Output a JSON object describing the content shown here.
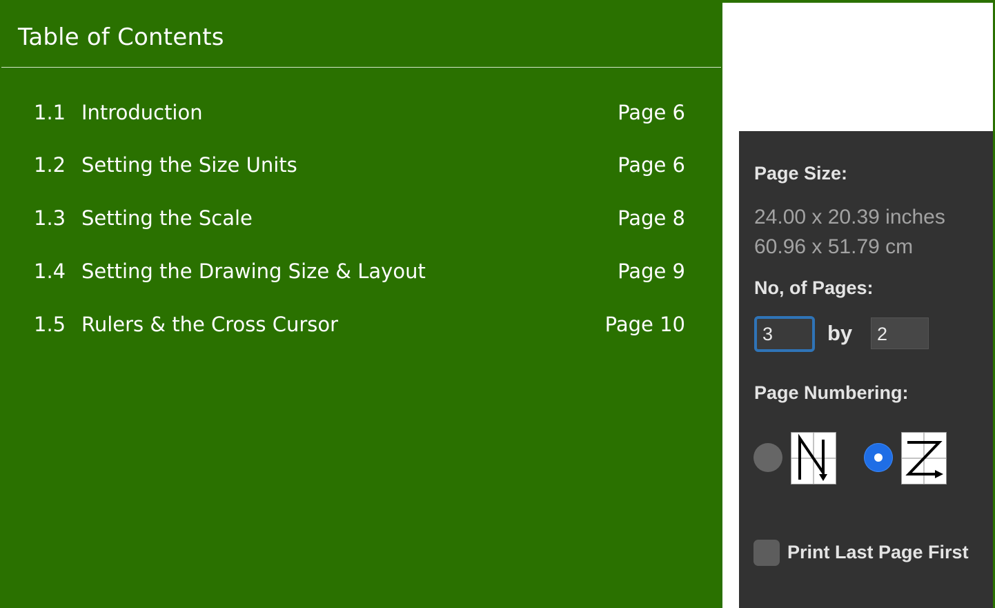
{
  "toc": {
    "title": "Table of Contents",
    "items": [
      {
        "number": "1.1",
        "label": "Introduction",
        "page": "Page 6"
      },
      {
        "number": "1.2",
        "label": "Setting the Size Units",
        "page": "Page 6"
      },
      {
        "number": "1.3",
        "label": "Setting the Scale",
        "page": "Page 8"
      },
      {
        "number": "1.4",
        "label": "Setting the Drawing Size & Layout",
        "page": "Page 9"
      },
      {
        "number": "1.5",
        "label": "Rulers & the Cross Cursor",
        "page": "Page 10"
      }
    ]
  },
  "settings": {
    "page_size_label": "Page Size:",
    "page_size_inches": "24.00 x 20.39 inches",
    "page_size_cm": "60.96 x 51.79 cm",
    "num_pages_label": "No, of Pages:",
    "pages_across": "3",
    "by_label": "by",
    "pages_down": "2",
    "page_numbering_label": "Page Numbering:",
    "page_numbering_options": [
      {
        "icon": "down-then-across-order-icon",
        "selected": false
      },
      {
        "icon": "across-then-down-order-icon",
        "selected": true
      }
    ],
    "print_last_page_first_label": "Print Last Page First",
    "print_last_page_first_checked": false
  },
  "colors": {
    "toc_background": "#2a7100",
    "panel_background": "#323232",
    "accent_blue": "#1f6ee6",
    "focus_ring": "#2f74b7"
  }
}
